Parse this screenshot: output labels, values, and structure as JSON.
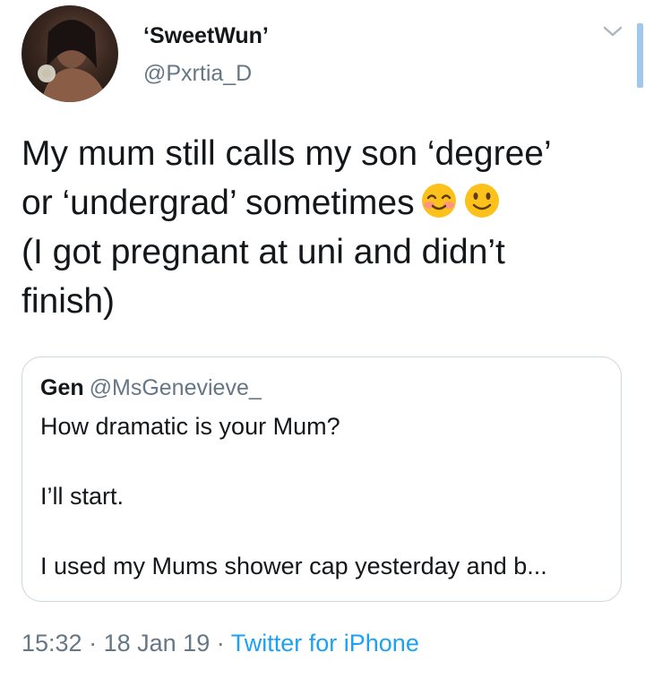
{
  "author": {
    "display_name": "‘SweetWun’",
    "handle": "@Pxrtia_D"
  },
  "tweet": {
    "lines": [
      "My mum still calls my son ‘degree’",
      "or ‘undergrad’ sometimes",
      "(I got pregnant at uni and didn’t",
      "finish)"
    ],
    "emojis": [
      "smiling-face-with-smiling-eyes-icon",
      "slightly-smiling-face-icon"
    ]
  },
  "quoted_tweet": {
    "name": "Gen",
    "handle": "@MsGenevieve_",
    "lines": [
      "How dramatic is your Mum?",
      "I’ll start.",
      "I used my Mums shower cap yesterday and b..."
    ]
  },
  "meta": {
    "time": "15:32",
    "separator1": "·",
    "date": "18 Jan 19",
    "separator2": "·",
    "source": "Twitter for iPhone"
  },
  "colors": {
    "text": "#14171a",
    "secondary": "#657786",
    "link": "#1da1f2",
    "border": "#ccd6dd"
  }
}
